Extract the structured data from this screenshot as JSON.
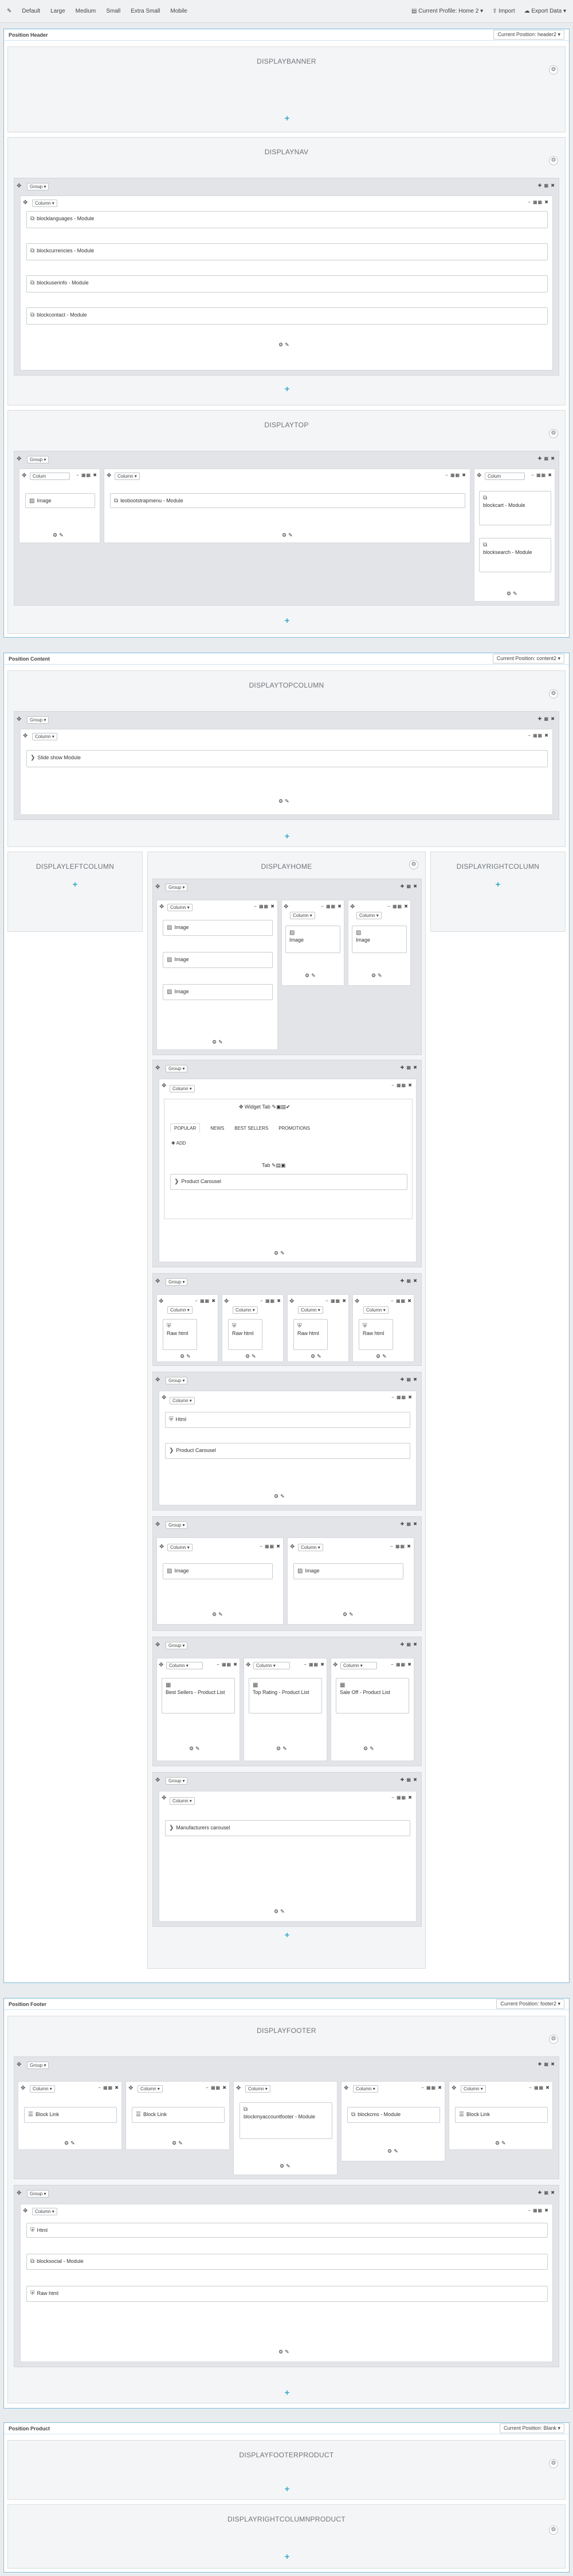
{
  "topbar": {
    "devices": [
      "Default",
      "Large",
      "Medium",
      "Small",
      "Extra Small",
      "Mobile"
    ],
    "profile": "Current Profile: Home 2 ▾",
    "import": "Import",
    "export": "Export Data ▾"
  },
  "labels": {
    "group": "Group ▾",
    "column": "Column ▾",
    "column_short": "Colum",
    "move": "✥",
    "add": "+",
    "gear": "⚙",
    "group_tools": "✚ ▦ ✖",
    "col_tools": "− ▦▦ ✖",
    "edit_tools": "⚙✎"
  },
  "sections": {
    "header": {
      "title": "Position Header",
      "position": "Current Position: header2 ▾"
    },
    "content": {
      "title": "Position Content",
      "position": "Current Position: content2 ▾"
    },
    "footer": {
      "title": "Position Footer",
      "position": "Current Position: footer2 ▾"
    },
    "product": {
      "title": "Position Product",
      "position": "Current Position: Blank ▾"
    }
  },
  "hooks": {
    "banner": "DISPLAYBANNER",
    "nav": "DISPLAYNAV",
    "top": "DISPLAYTOP",
    "topcolumn": "DISPLAYTOPCOLUMN",
    "leftcolumn": "DISPLAYLEFTCOLUMN",
    "home": "DISPLAYHOME",
    "rightcolumn": "DISPLAYRIGHTCOLUMN",
    "footer": "DISPLAYFOOTER",
    "footerproduct": "DISPLAYFOOTERPRODUCT",
    "rightcolumnproduct": "DISPLAYRIGHTCOLUMNPRODUCT"
  },
  "modules": {
    "nav": [
      "blocklanguages - Module",
      "blockcurrencies - Module",
      "blockuserinfo - Module",
      "blockcontact - Module"
    ],
    "image": "Image",
    "megamenu": "leobootstrapmenu - Module",
    "cart": "blockcart - Module",
    "search": "blocksearch - Module",
    "slideshow": "Slide show Module",
    "widget_tab": "Widget Tab",
    "tabs": [
      "POPULAR",
      "NEWS",
      "BEST SELLERS",
      "PROMOTIONS"
    ],
    "add": "ADD",
    "tab": "Tab",
    "product_carousel": "Product Carousel",
    "raw_html": "Raw html",
    "html": "Html",
    "best_sellers": "Best Sellers - Product List",
    "top_rating": "Top Rating - Product List",
    "sale_off": "Sale Off - Product List",
    "manufacturers": "Manufacturers carousel",
    "block_link": "Block Link",
    "myaccount_footer": "blockmyaccountfooter - Module",
    "cms": "blockcms - Module",
    "social": "blocksocial - Module"
  }
}
